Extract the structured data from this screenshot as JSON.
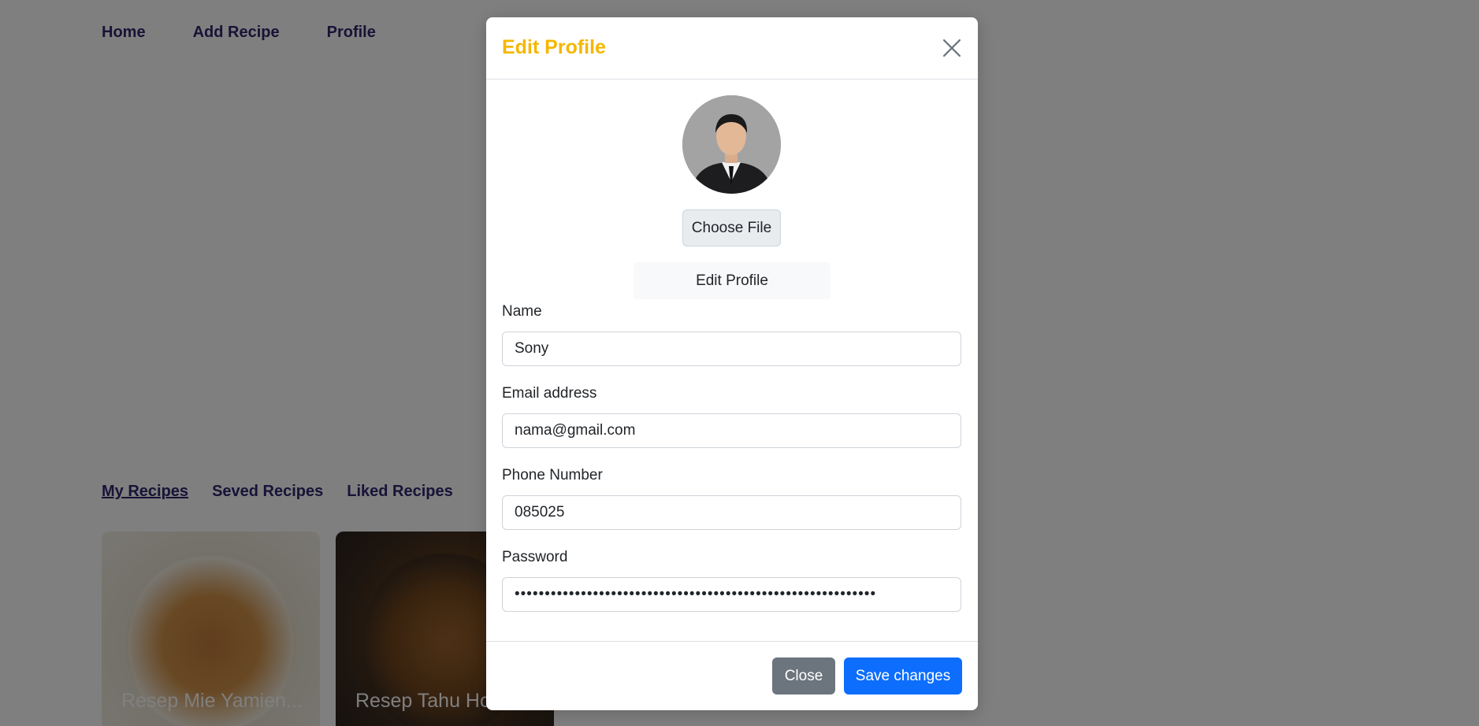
{
  "nav": {
    "home": "Home",
    "add_recipe": "Add Recipe",
    "profile": "Profile"
  },
  "tabs": {
    "my_recipes": "My Recipes",
    "saved_recipes": "Seved Recipes",
    "liked_recipes": "Liked Recipes"
  },
  "cards": [
    {
      "title": "Resep Mie Yamien..."
    },
    {
      "title": "Resep Tahu Ho..."
    }
  ],
  "modal": {
    "title": "Edit Profile",
    "choose_file_label": "Choose File",
    "edit_profile_label": "Edit Profile",
    "fields": {
      "name_label": "Name",
      "name_value": "Sony",
      "email_label": "Email address",
      "email_value": "nama@gmail.com",
      "phone_label": "Phone Number",
      "phone_value": "085025",
      "password_label": "Password",
      "password_value": "............................................................"
    },
    "close_label": "Close",
    "save_label": "Save changes"
  },
  "colors": {
    "nav_text": "#2e266f",
    "modal_title": "#f5b700",
    "primary": "#0d6efd",
    "secondary": "#6c757d"
  },
  "icons": {
    "modal_close": "close-icon"
  }
}
